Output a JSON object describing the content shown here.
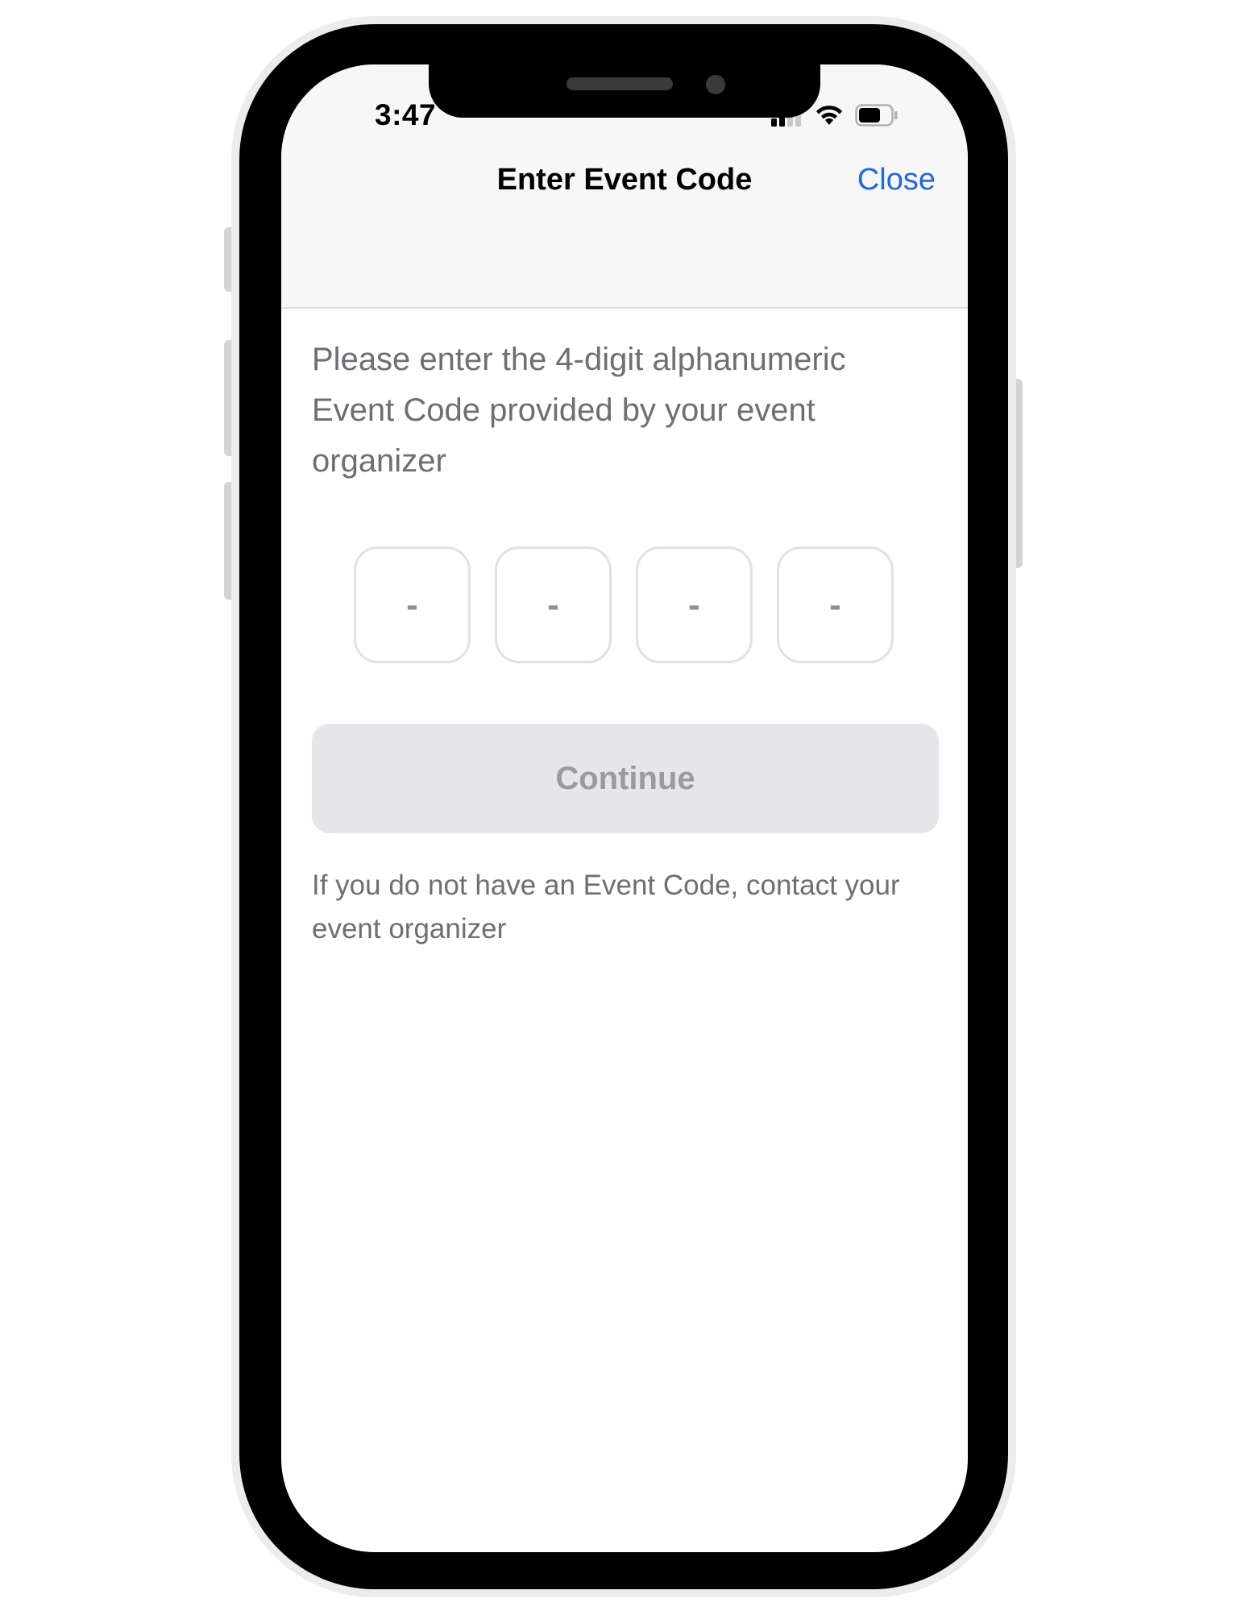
{
  "status_bar": {
    "time": "3:47",
    "signal_icon": "cellular-signal-icon",
    "wifi_icon": "wifi-icon",
    "battery_icon": "battery-icon"
  },
  "nav": {
    "title": "Enter Event Code",
    "close_label": "Close"
  },
  "instructions": "Please enter the 4-digit alphanumeric Event Code provided by your event organizer",
  "code_inputs": [
    {
      "placeholder": "-"
    },
    {
      "placeholder": "-"
    },
    {
      "placeholder": "-"
    },
    {
      "placeholder": "-"
    }
  ],
  "continue_label": "Continue",
  "footer": "If you do not have an Event Code, contact your event organizer",
  "colors": {
    "accent": "#2266e0",
    "muted_text": "#6e6e73",
    "disabled_button_bg": "#e5e5ea",
    "disabled_button_text": "#9a9aa0",
    "header_bg": "#f7f7f7"
  }
}
